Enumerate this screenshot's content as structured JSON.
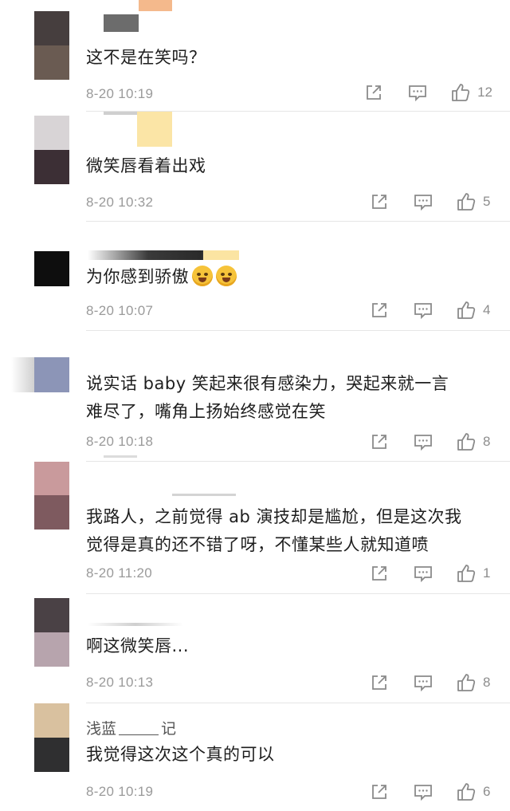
{
  "comments": [
    {
      "id": 1,
      "text": "这不是在笑吗？",
      "time": "8-20 10:19",
      "likes": "12",
      "avatar_colors": [
        "#463e3e",
        "#6a5b52"
      ]
    },
    {
      "id": 2,
      "text": "微笑唇看着出戏",
      "time": "8-20 10:32",
      "likes": "5",
      "avatar_colors": [
        "#d8d4d6",
        "#3c2f35"
      ]
    },
    {
      "id": 3,
      "text": "为你感到骄傲",
      "time": "8-20 10:07",
      "likes": "4",
      "avatar_colors": [
        "#0e0e0e",
        "#121212"
      ]
    },
    {
      "id": 4,
      "text_lines": [
        "说实话 baby 笑起来很有感染力，哭起来就一言",
        "难尽了，嘴角上扬始终感觉在笑"
      ],
      "time": "8-20 10:18",
      "likes": "8",
      "avatar_colors": [
        "#8c95b7",
        "#8c95b7"
      ]
    },
    {
      "id": 5,
      "text_lines": [
        "我路人，之前觉得 ab 演技却是尴尬，但是这次我",
        "觉得是真的还不错了呀，不懂某些人就知道喷"
      ],
      "time": "8-20 11:20",
      "likes": "1",
      "avatar_colors": [
        "#c99a9c",
        "#7e5a5f"
      ]
    },
    {
      "id": 6,
      "text": "啊这微笑唇...",
      "time": "8-20 10:13",
      "likes": "8",
      "avatar_colors": [
        "#4a4145",
        "#b7a4ad"
      ]
    },
    {
      "id": 7,
      "name_prefix": "浅蓝",
      "name_suffix": "记",
      "text": "我觉得这次这个真的可以",
      "time": "8-20 10:19",
      "likes": "6",
      "avatar_colors": [
        "#d9c19f",
        "#2f2f30"
      ]
    }
  ],
  "icons": {
    "share": "share-icon",
    "reply": "comment-icon",
    "like": "thumbs-up-icon"
  },
  "colors": {
    "text": "#1e1e1e",
    "meta": "#9a9a9a",
    "divider": "#e6e6e6"
  }
}
